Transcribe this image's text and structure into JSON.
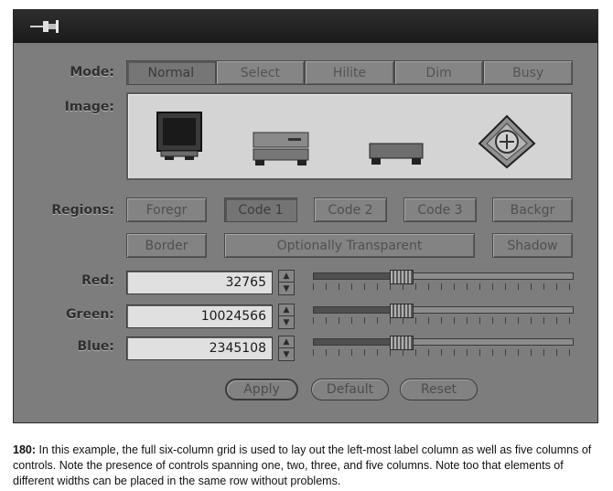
{
  "labels": {
    "mode": "Mode:",
    "image": "Image:",
    "regions": "Regions:",
    "red": "Red:",
    "green": "Green:",
    "blue": "Blue:"
  },
  "mode_tabs": [
    "Normal",
    "Select",
    "Hilite",
    "Dim",
    "Busy"
  ],
  "active_mode": "Normal",
  "image_icons": [
    "monitor-icon",
    "drive-icon",
    "flat-box-icon",
    "compass-icon"
  ],
  "regions_row1": [
    "Foregr",
    "Code 1",
    "Code 2",
    "Code 3",
    "Backgr"
  ],
  "regions_row2": [
    "Border",
    "Optionally Transparent",
    "Shadow"
  ],
  "color_values": {
    "red": "32765",
    "green": "10024566",
    "blue": "2345108"
  },
  "slider_levels": {
    "red": 0.34,
    "green": 0.34,
    "blue": 0.34
  },
  "buttons": {
    "apply": "Apply",
    "default": "Default",
    "reset": "Reset"
  },
  "caption": {
    "number": "180:",
    "text": "In this example, the full six-column grid is used to lay out the left-most label column as well as five columns of controls. Note the presence of controls spanning one, two, three, and five columns. Note too that elements of different widths can be placed in the same row without problems."
  }
}
